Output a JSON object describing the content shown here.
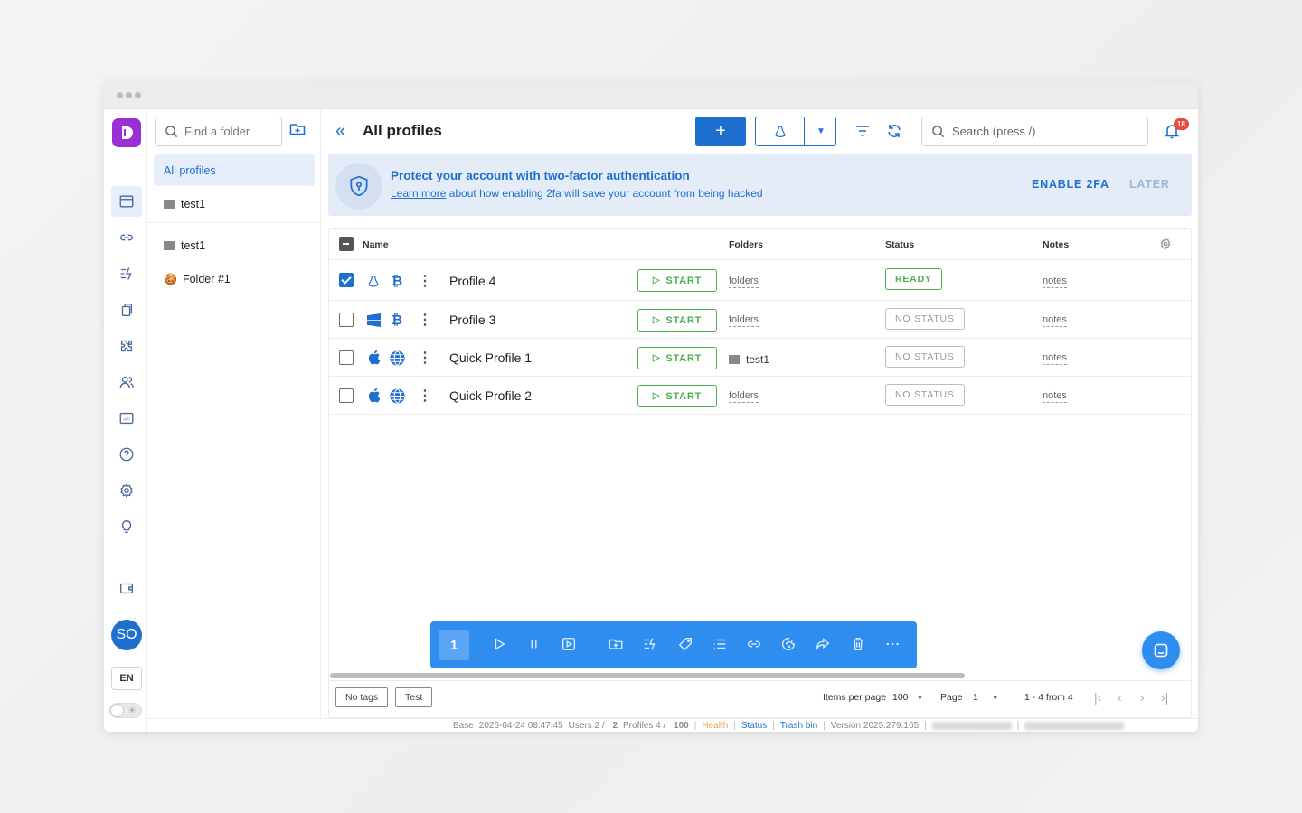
{
  "rail": {
    "logo_icon": "app-logo-icon",
    "avatar_initials": "SO",
    "language": "EN",
    "items": [
      "profiles-icon",
      "link-icon",
      "automation-icon",
      "copy-icon",
      "extension-icon",
      "team-icon",
      "api-icon",
      "help-icon",
      "settings-icon",
      "idea-icon",
      "wallet-icon"
    ]
  },
  "folders": {
    "search_placeholder": "Find a folder",
    "items": [
      {
        "label": "All profiles"
      },
      {
        "label": "test1"
      },
      {
        "label": "test1"
      },
      {
        "label": "Folder #1"
      }
    ]
  },
  "header": {
    "title": "All profiles",
    "add_label": "+",
    "search_placeholder": "Search (press /)",
    "notifications_count": "18"
  },
  "banner": {
    "title": "Protect your account with two-factor authentication",
    "learn_more": "Learn more",
    "subtitle_rest": " about how enabling 2fa will save your account from being hacked",
    "enable": "ENABLE 2FA",
    "later": "LATER"
  },
  "table": {
    "columns": {
      "name": "Name",
      "folders": "Folders",
      "status": "Status",
      "notes": "Notes"
    },
    "start_label": "START",
    "rows": [
      {
        "name": "Profile 4",
        "os": "linux-icon",
        "browser": "bitcoin-icon",
        "checked": true,
        "folder": "folders",
        "status": "READY",
        "notes": "notes"
      },
      {
        "name": "Profile 3",
        "os": "windows-icon",
        "browser": "bitcoin-icon",
        "checked": false,
        "folder": "folders",
        "status": "NO STATUS",
        "notes": "notes"
      },
      {
        "name": "Quick Profile 1",
        "os": "apple-icon",
        "browser": "globe-icon",
        "checked": false,
        "folder": "test1",
        "status": "NO STATUS",
        "notes": "notes"
      },
      {
        "name": "Quick Profile 2",
        "os": "apple-icon",
        "browser": "globe-icon",
        "checked": false,
        "folder": "folders",
        "status": "NO STATUS",
        "notes": "notes"
      }
    ]
  },
  "footer": {
    "tags": [
      "No tags",
      "Test"
    ],
    "items_per_page_label": "Items per page",
    "items_per_page": "100",
    "page_label": "Page",
    "page": "1",
    "range": "1 - 4 from 4"
  },
  "actionbar": {
    "selected_count": "1"
  },
  "statusbar": {
    "base": "Base",
    "datetime": "2026-04-24 08:47:45",
    "users_label": "Users 2 /",
    "users_total": "2",
    "profiles_label": "Profiles 4 /",
    "profiles_total": "100",
    "health": "Health",
    "status": "Status",
    "trash": "Trash bin",
    "version": "Version 2025.279.165"
  },
  "colors": {
    "accent": "#1d6fd0",
    "ready": "#4caf50",
    "health": "#e8a33d",
    "brand": "#9b2fd6"
  }
}
